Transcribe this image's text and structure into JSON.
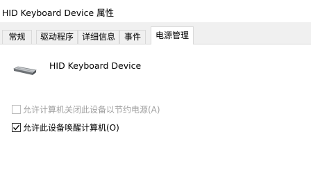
{
  "window": {
    "title": "HID Keyboard Device 属性"
  },
  "tabs": [
    {
      "label": "常规",
      "active": false
    },
    {
      "label": "驱动程序",
      "active": false
    },
    {
      "label": "详细信息",
      "active": false
    },
    {
      "label": "事件",
      "active": false
    },
    {
      "label": "电源管理",
      "active": true
    }
  ],
  "device": {
    "icon": "keyboard-icon",
    "name": "HID Keyboard Device"
  },
  "options": [
    {
      "label": "允许计算机关闭此设备以节约电源(A)",
      "checked": false,
      "enabled": false
    },
    {
      "label": "允许此设备唤醒计算机(O)",
      "checked": true,
      "enabled": true
    }
  ],
  "colors": {
    "panel": "#ffffff",
    "dialog_background": "#f0f0f0",
    "tab_border": "#d9d9d9",
    "disabled_text": "#a0a0a0"
  }
}
